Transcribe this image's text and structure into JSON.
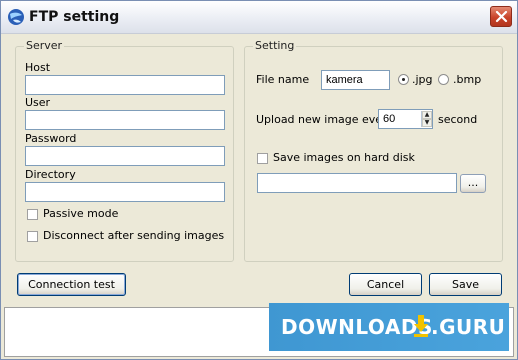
{
  "window": {
    "title": "FTP setting",
    "close_symbol": "×"
  },
  "server": {
    "legend": "Server",
    "host_label": "Host",
    "host_value": "",
    "user_label": "User",
    "user_value": "",
    "password_label": "Password",
    "password_value": "",
    "directory_label": "Directory",
    "directory_value": "",
    "passive_label": "Passive mode",
    "passive_checked": false,
    "disconnect_label": "Disconnect after sending images",
    "disconnect_checked": false
  },
  "setting": {
    "legend": "Setting",
    "file_name_label": "File name",
    "file_name_value": "kamera",
    "format_options": [
      ".jpg",
      ".bmp"
    ],
    "selected_format": ".jpg",
    "upload_label": "Upload new image every",
    "upload_value": "60",
    "upload_unit": "second",
    "save_label": "Save images on hard disk",
    "save_checked": false,
    "path_value": "",
    "browse_label": "..."
  },
  "buttons": {
    "connection_test": "Connection test",
    "cancel": "Cancel",
    "save": "Save"
  },
  "watermark": {
    "text_left": "DOWNLOADS",
    "text_right": "GURU",
    "colors": {
      "background": "#3f97d2",
      "arrow": "#f2c200"
    }
  },
  "icons": [
    "globe-app-icon",
    "close-icon",
    "spin-up-icon",
    "spin-down-icon",
    "download-arrow-icon"
  ]
}
